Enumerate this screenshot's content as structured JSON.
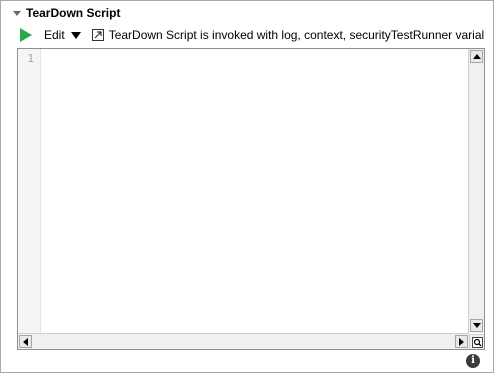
{
  "header": {
    "title": "TearDown Script",
    "collapse_icon": "expanded-triangle-icon"
  },
  "toolbar": {
    "run_icon": "play-icon",
    "run_color": "#2aa84a",
    "edit_label": "Edit",
    "hint_text": "TearDown Script is invoked with log, context, securityTestRunner varial"
  },
  "editor": {
    "line_numbers": [
      "1"
    ],
    "content": ""
  },
  "footer": {
    "info_icon": "info-icon",
    "info_glyph": "i"
  }
}
